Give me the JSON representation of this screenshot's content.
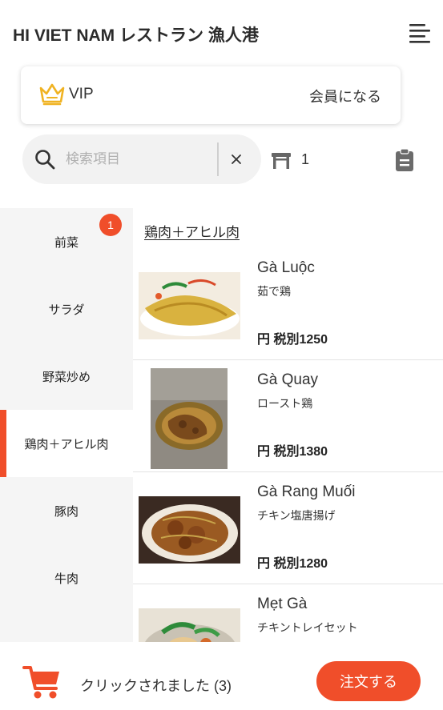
{
  "header": {
    "title": "HI VIET NAM レストラン 漁人港",
    "menu_icon": "hamburger-menu-icon"
  },
  "vip": {
    "label": "VIP",
    "action": "会員になる",
    "icon": "crown-icon",
    "color": "#f0b323"
  },
  "search": {
    "placeholder": "検索項目"
  },
  "table": {
    "number": "1"
  },
  "categories": [
    {
      "label": "前菜",
      "badge": "1"
    },
    {
      "label": "サラダ"
    },
    {
      "label": "野菜炒め"
    },
    {
      "label": "鶏肉＋アヒル肉",
      "active": true
    },
    {
      "label": "豚肉"
    },
    {
      "label": "牛肉"
    }
  ],
  "section": {
    "title": "鶏肉＋アヒル肉"
  },
  "items": [
    {
      "name": "Gà Luộc",
      "sub": "茹で鶏",
      "price": "円 税別1250"
    },
    {
      "name": "Gà Quay",
      "sub": "ロースト鶏",
      "price": "円 税別1380"
    },
    {
      "name": "Gà Rang Muối",
      "sub": "チキン塩唐揚げ",
      "price": "円 税別1280"
    },
    {
      "name": "Mẹt Gà",
      "sub": "チキントレイセット",
      "price": ""
    }
  ],
  "footer": {
    "cart_text": "クリックされました (3)",
    "order_label": "注文する"
  },
  "colors": {
    "accent": "#f04e2a",
    "sidebar_bg": "#f5f5f5"
  }
}
